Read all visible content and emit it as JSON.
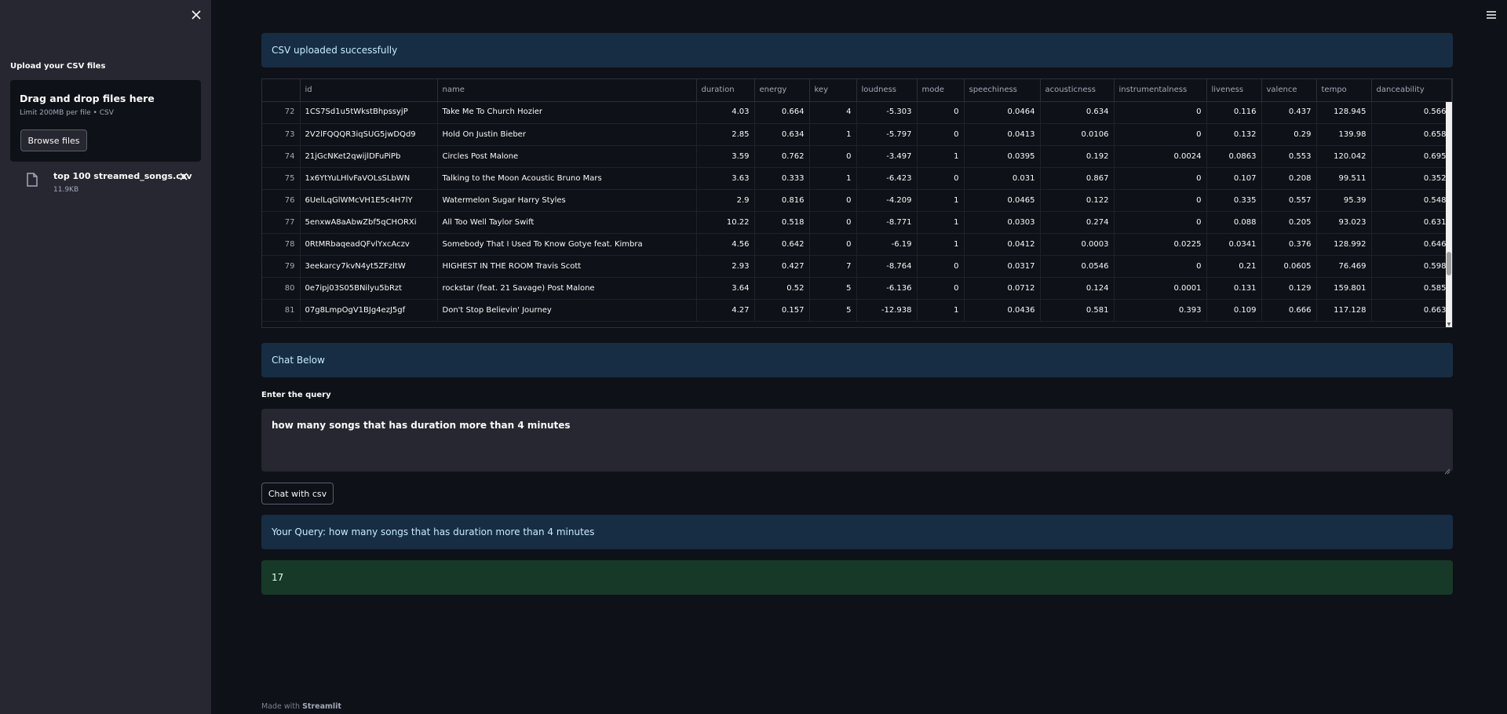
{
  "sidebar": {
    "upload_label": "Upload your CSV files",
    "dropzone_title": "Drag and drop files here",
    "dropzone_sub": "Limit 200MB per file • CSV",
    "browse_label": "Browse files",
    "file_name": "top 100 streamed_songs.csv",
    "file_size": "11.9KB"
  },
  "main": {
    "upload_success": "CSV uploaded successfully",
    "chat_header": "Chat Below",
    "query_label": "Enter the query",
    "query_value": "how many songs that has duration more than 4 minutes",
    "chat_button": "Chat with csv",
    "your_query": "Your Query: how many songs that has duration more than 4 minutes",
    "answer": "17"
  },
  "table": {
    "columns": [
      "",
      "id",
      "name",
      "duration",
      "energy",
      "key",
      "loudness",
      "mode",
      "speechiness",
      "acousticness",
      "instrumentalness",
      "liveness",
      "valence",
      "tempo",
      "danceability"
    ],
    "rows": [
      [
        "72",
        "1CS7Sd1u5tWkstBhpssyjP",
        "Take Me To Church Hozier",
        "4.03",
        "0.664",
        "4",
        "-5.303",
        "0",
        "0.0464",
        "0.634",
        "0",
        "0.116",
        "0.437",
        "128.945",
        "0.566"
      ],
      [
        "73",
        "2V2lFQQQR3iqSUG5jwDQd9",
        "Hold On Justin Bieber",
        "2.85",
        "0.634",
        "1",
        "-5.797",
        "0",
        "0.0413",
        "0.0106",
        "0",
        "0.132",
        "0.29",
        "139.98",
        "0.658"
      ],
      [
        "74",
        "21jGcNKet2qwijlDFuPiPb",
        "Circles Post Malone",
        "3.59",
        "0.762",
        "0",
        "-3.497",
        "1",
        "0.0395",
        "0.192",
        "0.0024",
        "0.0863",
        "0.553",
        "120.042",
        "0.695"
      ],
      [
        "75",
        "1x6YtYuLHlvFaVOLsSLbWN",
        "Talking to the Moon Acoustic Bruno Mars",
        "3.63",
        "0.333",
        "1",
        "-6.423",
        "0",
        "0.031",
        "0.867",
        "0",
        "0.107",
        "0.208",
        "99.511",
        "0.352"
      ],
      [
        "76",
        "6UelLqGlWMcVH1E5c4H7lY",
        "Watermelon Sugar Harry Styles",
        "2.9",
        "0.816",
        "0",
        "-4.209",
        "1",
        "0.0465",
        "0.122",
        "0",
        "0.335",
        "0.557",
        "95.39",
        "0.548"
      ],
      [
        "77",
        "5enxwA8aAbwZbf5qCHORXi",
        "All Too Well Taylor Swift",
        "10.22",
        "0.518",
        "0",
        "-8.771",
        "1",
        "0.0303",
        "0.274",
        "0",
        "0.088",
        "0.205",
        "93.023",
        "0.631"
      ],
      [
        "78",
        "0RtMRbaqeadQFvlYxcAczv",
        "Somebody That I Used To Know Gotye feat. Kimbra",
        "4.56",
        "0.642",
        "0",
        "-6.19",
        "1",
        "0.0412",
        "0.0003",
        "0.0225",
        "0.0341",
        "0.376",
        "128.992",
        "0.646"
      ],
      [
        "79",
        "3eekarcy7kvN4yt5ZFzltW",
        "HIGHEST IN THE ROOM Travis Scott",
        "2.93",
        "0.427",
        "7",
        "-8.764",
        "0",
        "0.0317",
        "0.0546",
        "0",
        "0.21",
        "0.0605",
        "76.469",
        "0.598"
      ],
      [
        "80",
        "0e7ipj03S05BNilyu5bRzt",
        "rockstar (feat. 21 Savage) Post Malone",
        "3.64",
        "0.52",
        "5",
        "-6.136",
        "0",
        "0.0712",
        "0.124",
        "0.0001",
        "0.131",
        "0.129",
        "159.801",
        "0.585"
      ],
      [
        "81",
        "07g8LmpOgV1BJg4ezJ5gf",
        "Don't Stop Believin' Journey",
        "4.27",
        "0.157",
        "5",
        "-12.938",
        "1",
        "0.0436",
        "0.581",
        "0.393",
        "0.109",
        "0.666",
        "117.128",
        "0.663"
      ]
    ]
  },
  "footer": {
    "prefix": "Made with ",
    "brand": "Streamlit"
  }
}
